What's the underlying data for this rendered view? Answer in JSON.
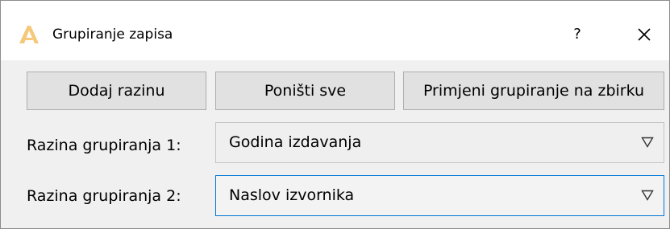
{
  "window": {
    "title": "Grupiranje zapisa",
    "help_label": "?",
    "close_icon": "close-icon",
    "app_icon": "app-logo-icon",
    "accent_color": "#0078d7",
    "logo_color": "#f5c97a"
  },
  "toolbar": {
    "add_level_label": "Dodaj razinu",
    "reset_all_label": "Poništi sve",
    "apply_label": "Primjeni grupiranje na zbirku"
  },
  "levels": [
    {
      "label": "Razina grupiranja 1:",
      "value": "Godina izdavanja",
      "focused": false
    },
    {
      "label": "Razina grupiranja 2:",
      "value": "Naslov izvornika",
      "focused": true
    }
  ]
}
